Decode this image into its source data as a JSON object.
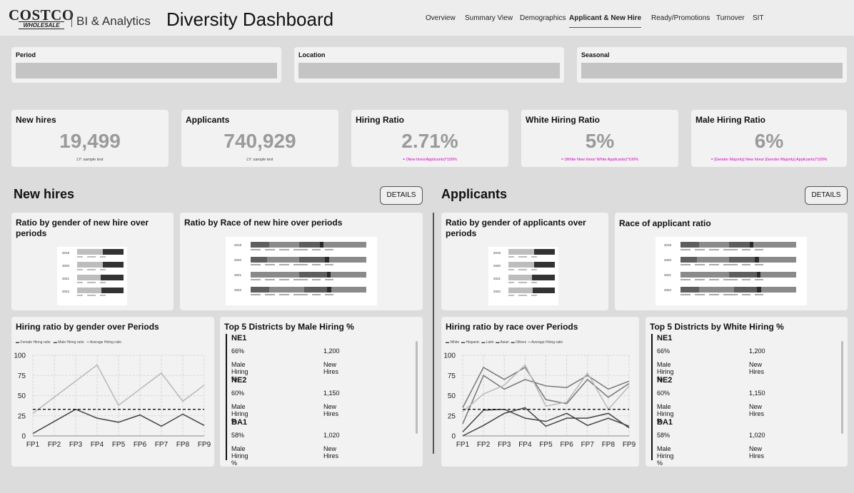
{
  "header": {
    "logo_main": "COSTCO",
    "logo_sub": "WHOLESALE",
    "bi_label": "BI & Analytics",
    "title": "Diversity Dashboard",
    "tabs": [
      {
        "label": "Overview"
      },
      {
        "label": "Summary View"
      },
      {
        "label": "Demographics"
      },
      {
        "label": "Applicant & New Hire",
        "active": true
      },
      {
        "label": "Ready/Promotions"
      },
      {
        "label": "Turnover"
      },
      {
        "label": "SIT"
      }
    ]
  },
  "filters": {
    "period_label": "Period",
    "location_label": "Location",
    "seasonal_label": "Seasonal"
  },
  "kpis": [
    {
      "label": "New hires",
      "value": "19,499",
      "note": "LY: sample text"
    },
    {
      "label": "Applicants",
      "value": "740,929",
      "note": "LY: sample text"
    },
    {
      "label": "Hiring Ratio",
      "value": "2.71%",
      "note": "= (New hires/Applicants)*100%"
    },
    {
      "label": "White Hiring Ratio",
      "value": "5%",
      "note": "= (White New hires/ White Applicants)*100%"
    },
    {
      "label": "Male Hiring Ratio",
      "value": "6%",
      "note": "= [Gender Majority] New hires/ [Gender Majority] Applicants)*100%"
    }
  ],
  "sections": {
    "new_hires_title": "New hires",
    "applicants_title": "Applicants",
    "details_label": "DETAILS"
  },
  "cards": {
    "nh_gender_title": "Ratio by gender of new hire over periods",
    "nh_race_title": "Ratio by Race of new hire over periods",
    "ap_gender_title": "Ratio by gender of applicants over periods",
    "ap_race_title": "Race of applicant ratio",
    "nh_line_title": "Hiring ratio by gender over Periods",
    "ap_line_title": "Hiring ratio by race over Periods",
    "nh_top_title": "Top 5 Districts by Male Hiring %",
    "ap_top_title": "Top 5 Districts by White Hiring %"
  },
  "mini_years": [
    "2019",
    "2020",
    "2021",
    "2022"
  ],
  "colors": {
    "bar_light": "#bdbdbd",
    "bar_mid": "#8a8a8a",
    "bar_dark": "#333333",
    "line_light": "#b8b8b8",
    "line_dark": "#444444",
    "line_mid": "#777777",
    "pink_note": "#d400c0"
  },
  "nh_districts": [
    {
      "name": "NE1",
      "pct": "66%",
      "count": "1,200",
      "pct_label": "Male Hiring %",
      "count_label": "New Hires"
    },
    {
      "name": "NE2",
      "pct": "60%",
      "count": "1,150",
      "pct_label": "Male Hiring %",
      "count_label": "New Hires"
    },
    {
      "name": "BA1",
      "pct": "58%",
      "count": "1,020",
      "pct_label": "Male Hiring %",
      "count_label": "New Hires"
    }
  ],
  "ap_districts": [
    {
      "name": "NE1",
      "pct": "66%",
      "count": "1,200",
      "pct_label": "Male Hiring %",
      "count_label": "New Hires"
    },
    {
      "name": "NE2",
      "pct": "60%",
      "count": "1,150",
      "pct_label": "Male Hiring %",
      "count_label": "New Hires"
    },
    {
      "name": "BA1",
      "pct": "58%",
      "count": "1,020",
      "pct_label": "Male Hiring %",
      "count_label": "New Hires"
    }
  ],
  "chart_data": [
    {
      "type": "line",
      "x": [
        "FP1",
        "FP2",
        "FP3",
        "FP4",
        "FP5",
        "FP6",
        "FP7",
        "FP8",
        "FP9"
      ],
      "ylim": [
        0,
        100
      ],
      "yticks": [
        0,
        25,
        50,
        75,
        100
      ],
      "grid": true,
      "legend": "top-left",
      "series": [
        {
          "name": "Female Hiring ratio",
          "values": [
            3,
            18,
            33,
            22,
            17,
            26,
            12,
            27,
            13
          ]
        },
        {
          "name": "Male Hiring ratio",
          "values": [
            28,
            48,
            68,
            88,
            38,
            58,
            78,
            43,
            63
          ]
        },
        {
          "name": "Average Hiring ratio",
          "values": [
            33,
            33,
            33,
            33,
            33,
            33,
            33,
            33,
            33
          ],
          "dashed": true
        }
      ]
    },
    {
      "type": "line",
      "x": [
        "FP1",
        "FP2",
        "FP3",
        "FP4",
        "FP5",
        "FP6",
        "FP7",
        "FP8",
        "FP9"
      ],
      "ylim": [
        0,
        100
      ],
      "yticks": [
        0,
        25,
        50,
        75,
        100
      ],
      "grid": true,
      "legend": "top-left",
      "series": [
        {
          "name": "White",
          "values": [
            35,
            85,
            70,
            85,
            45,
            40,
            70,
            48,
            65
          ]
        },
        {
          "name": "Hispanic",
          "values": [
            15,
            75,
            58,
            70,
            62,
            60,
            75,
            58,
            68
          ]
        },
        {
          "name": "Latin",
          "values": [
            0,
            13,
            28,
            35,
            12,
            22,
            22,
            28,
            10
          ]
        },
        {
          "name": "Asian",
          "values": [
            30,
            52,
            63,
            88,
            37,
            42,
            78,
            33,
            62
          ]
        },
        {
          "name": "Others",
          "values": [
            5,
            32,
            33,
            22,
            18,
            28,
            13,
            22,
            12
          ]
        },
        {
          "name": "Average Hiring ratio",
          "values": [
            33,
            33,
            33,
            33,
            33,
            33,
            33,
            33,
            33
          ],
          "dashed": true
        }
      ]
    }
  ]
}
